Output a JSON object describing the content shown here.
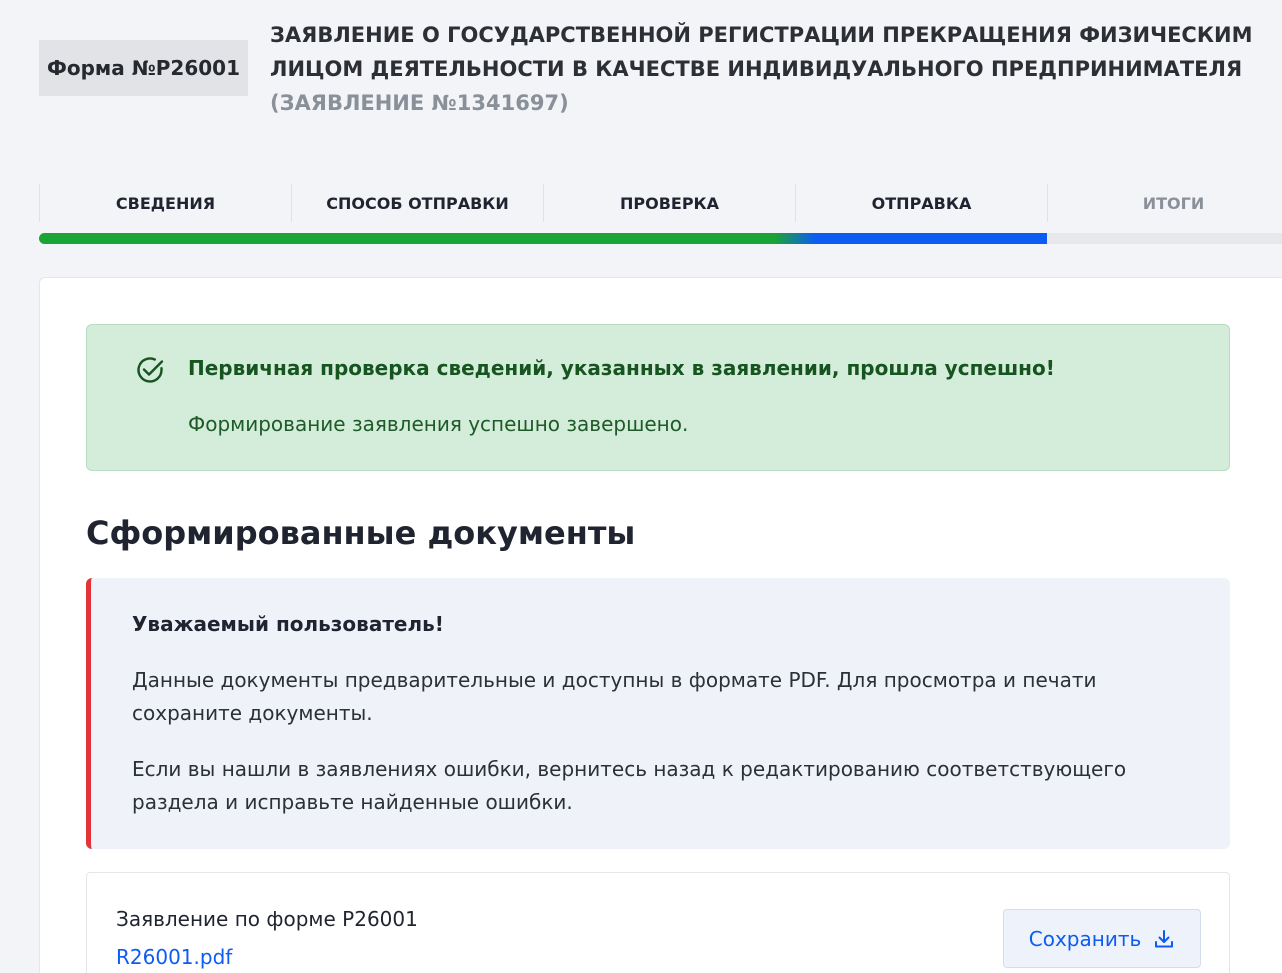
{
  "header": {
    "form_badge": "Форма №Р26001",
    "title_main": "ЗАЯВЛЕНИЕ О ГОСУДАРСТВЕННОЙ РЕГИСТРАЦИИ ПРЕКРАЩЕНИЯ ФИЗИЧЕСКИМ ЛИЦОМ ДЕЯТЕЛЬНОСТИ В КАЧЕСТВЕ ИНДИВИДУАЛЬНОГО ПРЕДПРИНИМАТЕЛЯ",
    "title_sub": "(ЗАЯВЛЕНИЕ №1341697)"
  },
  "stepper": {
    "steps": [
      {
        "label": "СВЕДЕНИЯ"
      },
      {
        "label": "СПОСОБ ОТПРАВКИ"
      },
      {
        "label": "ПРОВЕРКА"
      },
      {
        "label": "ОТПРАВКА"
      },
      {
        "label": "ИТОГИ"
      }
    ],
    "current_step": 4,
    "progress_completed_color": "#1aa435",
    "progress_current_color": "#0d5cf2"
  },
  "success": {
    "icon": "check-circle-icon",
    "title": "Первичная проверка сведений, указанных в заявлении, прошла успешно!",
    "text": "Формирование заявления успешно завершено."
  },
  "documents": {
    "section_title": "Сформированные документы",
    "notice": {
      "title": "Уважаемый пользователь!",
      "paragraph1": "Данные документы предварительные и доступны в формате PDF. Для просмотра и печати сохраните документы.",
      "paragraph2": "Если вы нашли в заявлениях ошибки, вернитесь назад к редактированию соответствующего раздела и исправьте найденные ошибки.",
      "accent_color": "#e13338"
    },
    "items": [
      {
        "name": "Заявление по форме Р26001",
        "file": "R26001.pdf",
        "save_label": "Сохранить",
        "save_icon": "download-icon"
      }
    ]
  }
}
